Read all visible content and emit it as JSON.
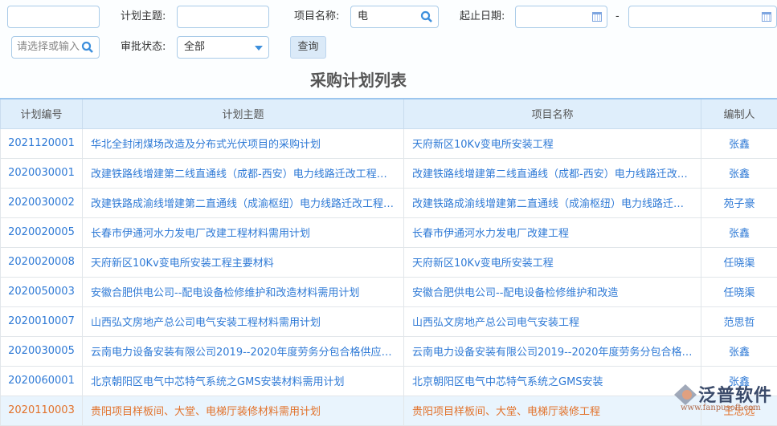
{
  "filters": {
    "first_value": "",
    "plan_topic_label": "计划主题:",
    "plan_topic_value": "",
    "project_name_label": "项目名称:",
    "project_name_value": "电",
    "date_label": "起止日期:",
    "date_sep": "-",
    "date_start": "",
    "date_end": "",
    "selector_placeholder": "请选择或输入",
    "approval_label": "审批状态:",
    "approval_value": "全部",
    "query_button": "查询"
  },
  "title": "采购计划列表",
  "table": {
    "headers": [
      "计划编号",
      "计划主题",
      "项目名称",
      "编制人"
    ],
    "rows": [
      [
        "2021120001",
        "华北全封闭煤场改造及分布式光伏项目的采购计划",
        "天府新区10Kv变电所安装工程",
        "张鑫"
      ],
      [
        "2020030001",
        "改建铁路线增建第二线直通线（成都-西安）电力线路迁改工程…",
        "改建铁路线增建第二线直通线（成都-西安）电力线路迁改…",
        "张鑫"
      ],
      [
        "2020030002",
        "改建铁路成渝线增建第二直通线（成渝枢纽）电力线路迁改工程…",
        "改建铁路成渝线增建第二直通线（成渝枢纽）电力线路迁…",
        "苑子豪"
      ],
      [
        "2020020005",
        "长春市伊通河水力发电厂改建工程材料需用计划",
        "长春市伊通河水力发电厂改建工程",
        "张鑫"
      ],
      [
        "2020020008",
        "天府新区10Kv变电所安装工程主要材料",
        "天府新区10Kv变电所安装工程",
        "任晓渠"
      ],
      [
        "2020050003",
        "安徽合肥供电公司--配电设备检修维护和改造材料需用计划",
        "安徽合肥供电公司--配电设备检修维护和改造",
        "任晓渠"
      ],
      [
        "2020010007",
        "山西弘文房地产总公司电气安装工程材料需用计划",
        "山西弘文房地产总公司电气安装工程",
        "范思哲"
      ],
      [
        "2020030005",
        "云南电力设备安装有限公司2019--2020年度劳务分包合格供应商…",
        "云南电力设备安装有限公司2019--2020年度劳务分包合格…",
        "张鑫"
      ],
      [
        "2020060001",
        "北京朝阳区电气中芯特气系统之GMS安装材料需用计划",
        "北京朝阳区电气中芯特气系统之GMS安装",
        "张鑫"
      ],
      [
        "2020110003",
        "贵阳项目样板间、大堂、电梯厅装修材料需用计划",
        "贵阳项目样板间、大堂、电梯厅装修工程",
        "王忠远"
      ]
    ],
    "highlighted_row": 9
  },
  "watermark": {
    "name": "泛普软件",
    "url": "www.fanpusoft.com"
  }
}
